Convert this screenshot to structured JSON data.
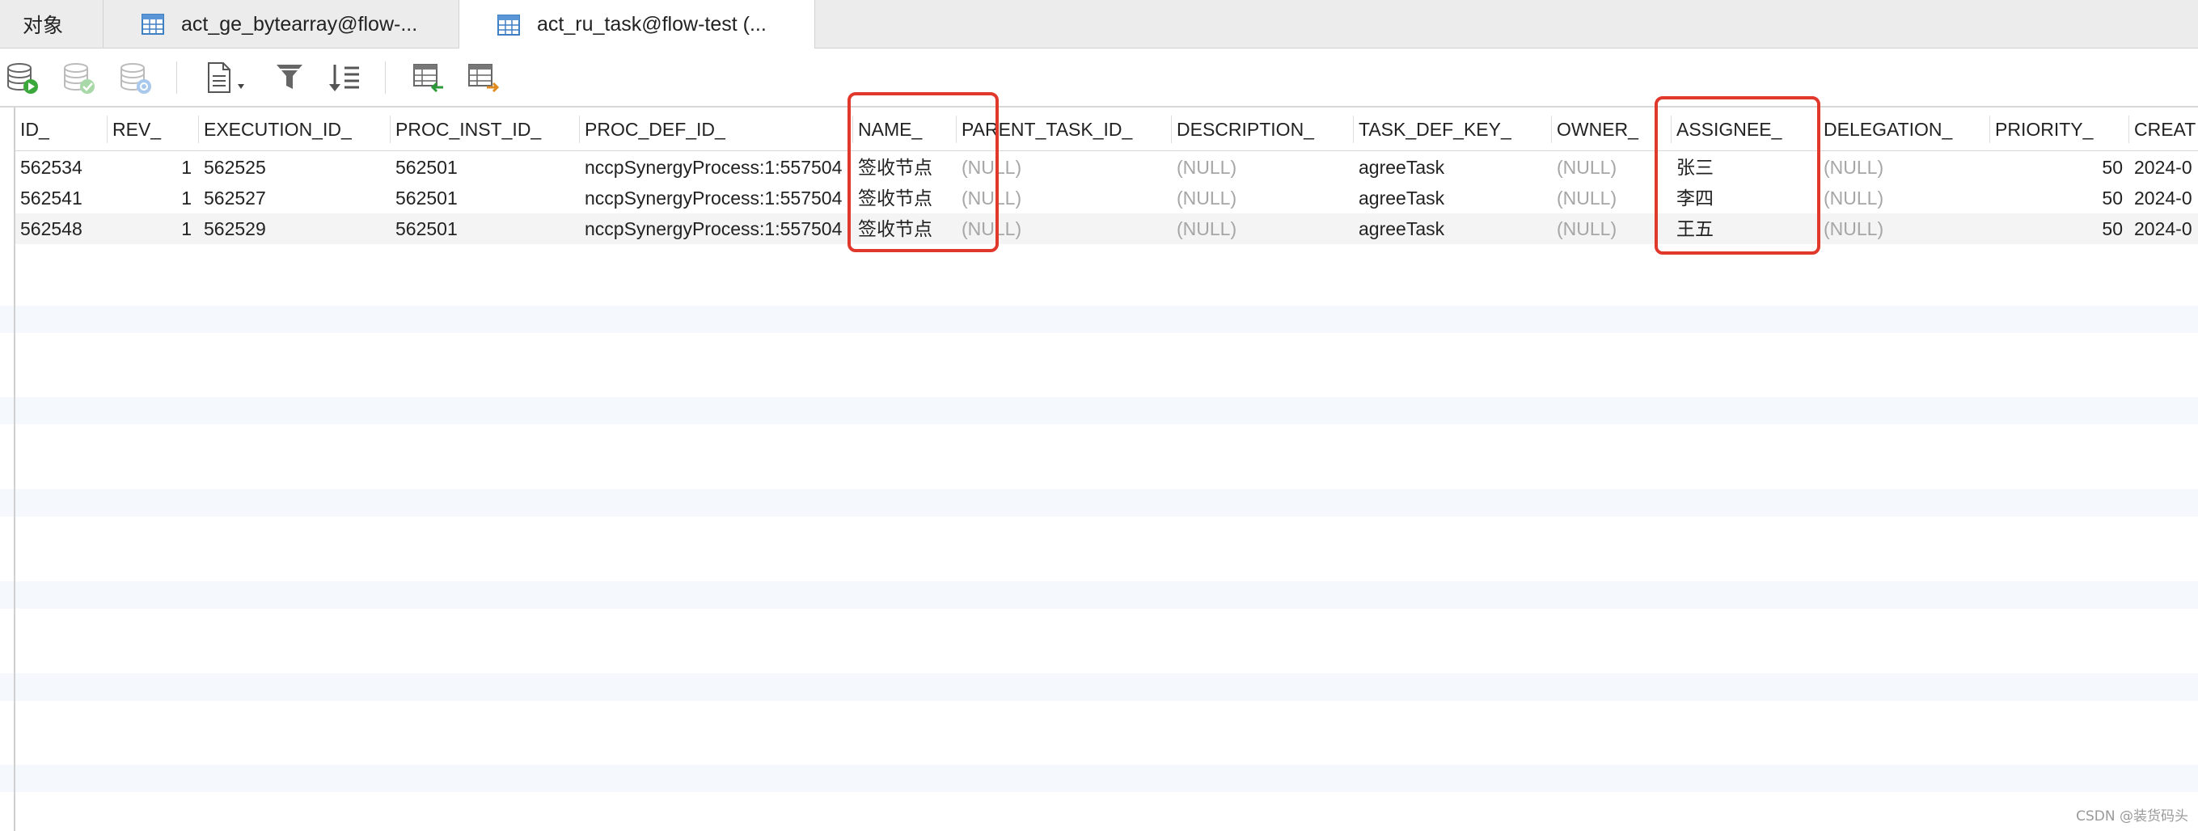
{
  "tabs": {
    "objects": "对象",
    "tab1": "act_ge_bytearray@flow-...",
    "tab2": "act_ru_task@flow-test (..."
  },
  "toolbar_icons": [
    "db-run-icon",
    "db-commit-icon",
    "db-refresh-icon",
    "text-view-icon",
    "filter-icon",
    "sort-icon",
    "import-icon",
    "export-icon"
  ],
  "columns": [
    "ID_",
    "REV_",
    "EXECUTION_ID_",
    "PROC_INST_ID_",
    "PROC_DEF_ID_",
    "NAME_",
    "PARENT_TASK_ID_",
    "DESCRIPTION_",
    "TASK_DEF_KEY_",
    "OWNER_",
    "ASSIGNEE_",
    "DELEGATION_",
    "PRIORITY_",
    "CREAT"
  ],
  "rows": [
    [
      "562534",
      "1",
      "562525",
      "562501",
      "nccpSynergyProcess:1:557504",
      "签收节点",
      "(NULL)",
      "(NULL)",
      "agreeTask",
      "(NULL)",
      "张三",
      "(NULL)",
      "50",
      "2024-0"
    ],
    [
      "562541",
      "1",
      "562527",
      "562501",
      "nccpSynergyProcess:1:557504",
      "签收节点",
      "(NULL)",
      "(NULL)",
      "agreeTask",
      "(NULL)",
      "李四",
      "(NULL)",
      "50",
      "2024-0"
    ],
    [
      "562548",
      "1",
      "562529",
      "562501",
      "nccpSynergyProcess:1:557504",
      "签收节点",
      "(NULL)",
      "(NULL)",
      "agreeTask",
      "(NULL)",
      "王五",
      "(NULL)",
      "50",
      "2024-0"
    ]
  ],
  "watermark": "CSDN @装货码头",
  "colors": {
    "highlight": "#e0392b",
    "null_text": "#a6a6a6",
    "tab_bar": "#ececec"
  }
}
